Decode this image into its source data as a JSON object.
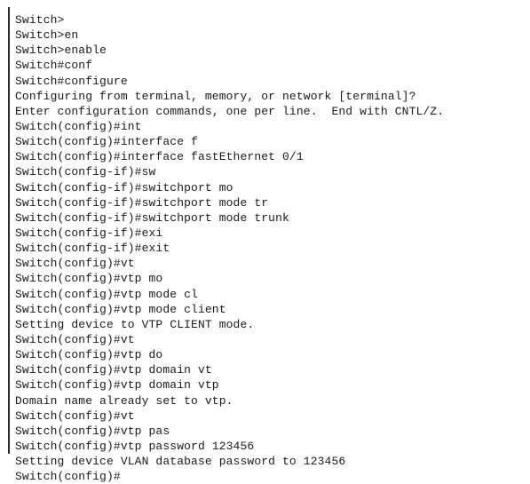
{
  "window": {
    "type": "terminal-console",
    "background_color": "#ffffff",
    "text_color": "#1a1a1a",
    "border_color": "#2b2b2b"
  },
  "terminal": {
    "device_prompt_user": "Switch>",
    "device_prompt_enable": "Switch#",
    "device_prompt_config": "Switch(config)#",
    "device_prompt_config_if": "Switch(config-if)#",
    "cursor_line_index": 28,
    "lines": [
      "Switch>",
      "Switch>en",
      "Switch>enable",
      "Switch#conf",
      "Switch#configure",
      "Configuring from terminal, memory, or network [terminal]?",
      "Enter configuration commands, one per line.  End with CNTL/Z.",
      "Switch(config)#int",
      "Switch(config)#interface f",
      "Switch(config)#interface fastEthernet 0/1",
      "Switch(config-if)#sw",
      "Switch(config-if)#switchport mo",
      "Switch(config-if)#switchport mode tr",
      "Switch(config-if)#switchport mode trunk",
      "Switch(config-if)#exi",
      "Switch(config-if)#exit",
      "Switch(config)#vt",
      "Switch(config)#vtp mo",
      "Switch(config)#vtp mode cl",
      "Switch(config)#vtp mode client",
      "Setting device to VTP CLIENT mode.",
      "Switch(config)#vt",
      "Switch(config)#vtp do",
      "Switch(config)#vtp domain vt",
      "Switch(config)#vtp domain vtp",
      "Domain name already set to vtp.",
      "Switch(config)#vt",
      "Switch(config)#vtp pas",
      "Switch(config)#vtp password 123456",
      "Setting device VLAN database password to 123456",
      "Switch(config)#"
    ]
  }
}
